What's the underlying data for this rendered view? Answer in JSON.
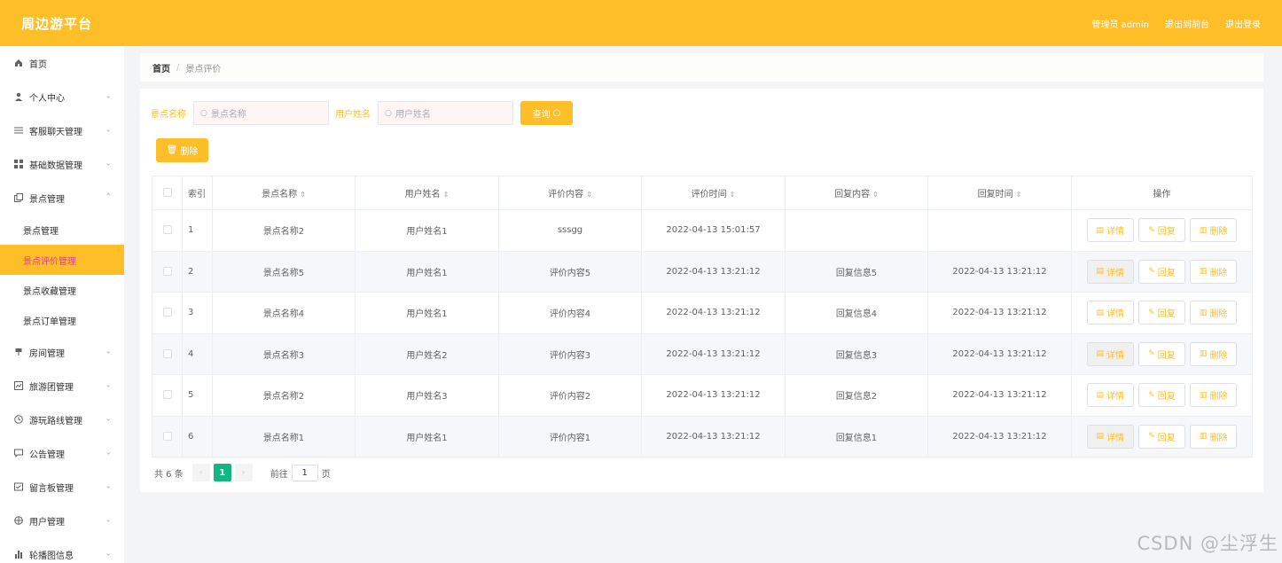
{
  "header": {
    "brand": "周边游平台",
    "user_label": "管理员 admin",
    "front_link": "退出到前台",
    "logout_link": "退出登录"
  },
  "sidebar": {
    "items": [
      {
        "label": "首页",
        "icon": "home-icon"
      },
      {
        "label": "个人中心",
        "icon": "user-icon"
      },
      {
        "label": "客服聊天管理",
        "icon": "list-icon"
      },
      {
        "label": "基础数据管理",
        "icon": "grid-icon"
      },
      {
        "label": "景点管理",
        "icon": "copy-icon"
      },
      {
        "label": "房间管理",
        "icon": "pin-icon"
      },
      {
        "label": "旅游团管理",
        "icon": "chart-icon"
      },
      {
        "label": "游玩路线管理",
        "icon": "clock-icon"
      },
      {
        "label": "公告管理",
        "icon": "message-icon"
      },
      {
        "label": "留言板管理",
        "icon": "board-icon"
      },
      {
        "label": "用户管理",
        "icon": "globe-icon"
      },
      {
        "label": "轮播图信息",
        "icon": "bar-chart-icon"
      }
    ],
    "sub_items": [
      "景点管理",
      "景点评价管理",
      "景点收藏管理",
      "景点订单管理"
    ]
  },
  "breadcrumb": {
    "home": "首页",
    "separator": "/",
    "current": "景点评价"
  },
  "filters": {
    "spot_label": "景点名称",
    "spot_placeholder": "景点名称",
    "user_label": "用户姓名",
    "user_placeholder": "用户姓名",
    "query_button": "查询",
    "delete_button": "删除"
  },
  "table": {
    "columns": [
      "索引",
      "景点名称",
      "用户姓名",
      "评价内容",
      "评价时间",
      "回复内容",
      "回复时间",
      "操作"
    ],
    "action_labels": {
      "detail": "详情",
      "reply": "回复",
      "delete": "删除"
    },
    "rows": [
      {
        "index": "1",
        "spot": "景点名称2",
        "user": "用户姓名1",
        "content": "sssgg",
        "time": "2022-04-13 15:01:57",
        "reply": "",
        "reply_time": ""
      },
      {
        "index": "2",
        "spot": "景点名称5",
        "user": "用户姓名1",
        "content": "评价内容5",
        "time": "2022-04-13 13:21:12",
        "reply": "回复信息5",
        "reply_time": "2022-04-13 13:21:12"
      },
      {
        "index": "3",
        "spot": "景点名称4",
        "user": "用户姓名1",
        "content": "评价内容4",
        "time": "2022-04-13 13:21:12",
        "reply": "回复信息4",
        "reply_time": "2022-04-13 13:21:12"
      },
      {
        "index": "4",
        "spot": "景点名称3",
        "user": "用户姓名2",
        "content": "评价内容3",
        "time": "2022-04-13 13:21:12",
        "reply": "回复信息3",
        "reply_time": "2022-04-13 13:21:12"
      },
      {
        "index": "5",
        "spot": "景点名称2",
        "user": "用户姓名3",
        "content": "评价内容2",
        "time": "2022-04-13 13:21:12",
        "reply": "回复信息2",
        "reply_time": "2022-04-13 13:21:12"
      },
      {
        "index": "6",
        "spot": "景点名称1",
        "user": "用户姓名1",
        "content": "评价内容1",
        "time": "2022-04-13 13:21:12",
        "reply": "回复信息1",
        "reply_time": "2022-04-13 13:21:12"
      }
    ]
  },
  "pagination": {
    "total": "共 6 条",
    "current_page": "1",
    "goto_label": "前往",
    "goto_value": "1",
    "page_suffix": "页"
  },
  "watermark": "CSDN @尘浮生",
  "colors": {
    "accent": "#fdbe28",
    "active_text": "#e0408a",
    "page_active": "#11b682"
  }
}
